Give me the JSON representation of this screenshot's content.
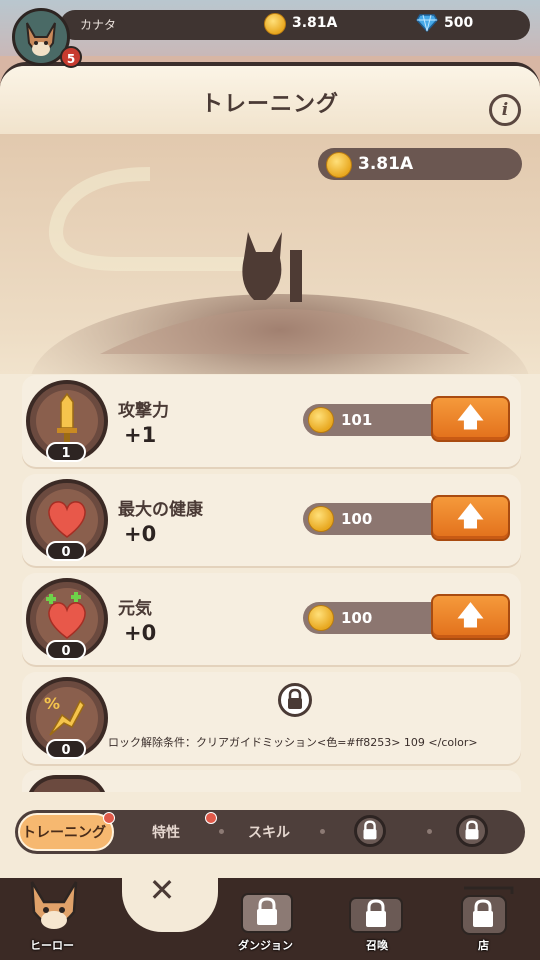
{
  "topbar": {
    "player_name": "カナタ",
    "level": "5",
    "coins": "3.81A",
    "gems": "500",
    "icons": [
      "fox-avatar-icon",
      "coin-icon",
      "diamond-icon"
    ]
  },
  "panel": {
    "title": "トレーニング",
    "info_label": "i",
    "resource_coins": "3.81A"
  },
  "stats": [
    {
      "name": "攻撃力",
      "value": "+1",
      "level": "1",
      "cost": "101",
      "icon": "sword-icon"
    },
    {
      "name": "最大の健康",
      "value": "+0",
      "level": "0",
      "cost": "100",
      "icon": "heart-icon"
    },
    {
      "name": "元気",
      "value": "+0",
      "level": "0",
      "cost": "100",
      "icon": "heart-plus-icon"
    },
    {
      "level": "0",
      "icon": "percent-sword-icon",
      "lock_condition": "ロック解除条件：クリアガイドミッション<色=#ff8253> 109 </color>"
    }
  ],
  "upgrade_label": "🡅",
  "tabs": [
    {
      "label": "トレーニング",
      "active": true,
      "dot": true
    },
    {
      "label": "特性",
      "dot": true
    },
    {
      "label": "スキル"
    },
    {
      "label": "",
      "locked": true
    },
    {
      "label": "",
      "locked": true
    }
  ],
  "close_label": "✕",
  "nav": [
    {
      "label": "ヒーロー",
      "icon": "fox-hero-icon"
    },
    {
      "label": "ダンジョン",
      "icon": "map-scroll-icon",
      "locked": true
    },
    {
      "label": "召喚",
      "icon": "treasure-chest-icon",
      "locked": true
    },
    {
      "label": "店",
      "icon": "shop-sign-icon",
      "locked": true
    }
  ],
  "colors": {
    "accent": "#e2701b",
    "panel": "#f4ead8",
    "dark": "#3b2a25"
  }
}
